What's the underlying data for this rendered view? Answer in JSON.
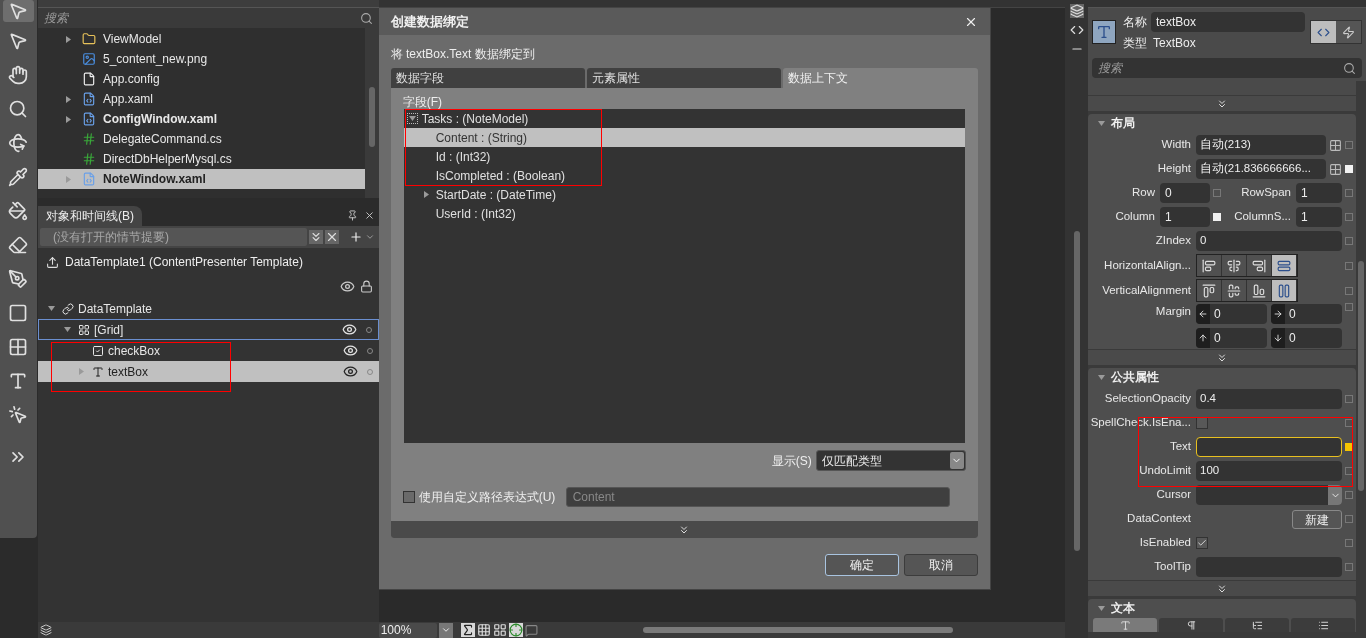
{
  "tools": [
    {
      "kind": "select",
      "selected": true
    },
    {
      "kind": "direct-select",
      "selected": false
    },
    {
      "kind": "pan",
      "selected": false
    },
    {
      "kind": "zoom",
      "selected": false
    },
    {
      "kind": "orbit",
      "selected": false
    },
    {
      "kind": "eyedropper",
      "selected": false
    },
    {
      "kind": "paint-bucket",
      "selected": false
    },
    {
      "kind": "gradient",
      "selected": false
    },
    {
      "kind": "pen",
      "selected": false
    },
    {
      "kind": "rectangle",
      "selected": false
    },
    {
      "kind": "grid",
      "selected": false
    },
    {
      "kind": "textblock",
      "selected": false
    },
    {
      "kind": "button",
      "selected": false
    },
    {
      "kind": "assets",
      "selected": false
    }
  ],
  "project": {
    "search_placeholder": "搜索",
    "items": [
      {
        "label": "ViewModel",
        "kind": "folder",
        "expandable": true,
        "bold": false,
        "selected": false
      },
      {
        "label": "5_content_new.png",
        "kind": "image",
        "expandable": false,
        "bold": false,
        "selected": false
      },
      {
        "label": "App.config",
        "kind": "file",
        "expandable": false,
        "bold": false,
        "selected": false
      },
      {
        "label": "App.xaml",
        "kind": "xaml",
        "expandable": true,
        "bold": false,
        "selected": false
      },
      {
        "label": "ConfigWindow.xaml",
        "kind": "xaml",
        "expandable": true,
        "bold": true,
        "selected": false
      },
      {
        "label": "DelegateCommand.cs",
        "kind": "cs",
        "expandable": false,
        "bold": false,
        "selected": false
      },
      {
        "label": "DirectDbHelperMysql.cs",
        "kind": "cs",
        "expandable": false,
        "bold": false,
        "selected": false
      },
      {
        "label": "NoteWindow.xaml",
        "kind": "xaml",
        "expandable": true,
        "bold": true,
        "selected": true
      }
    ]
  },
  "objects": {
    "title": "对象和时间线(B)",
    "storyboard_placeholder": "(没有打开的情节提要)",
    "scope": "DataTemplate1 (ContentPresenter Template)",
    "tree": [
      {
        "label": "DataTemplate",
        "kind": "template",
        "expanded": true,
        "selected": false,
        "children": [
          {
            "label": "[Grid]",
            "kind": "grid",
            "expanded": true,
            "selected": false,
            "children": [
              {
                "label": "checkBox",
                "kind": "checkbox",
                "selected": false
              },
              {
                "label": "textBox",
                "kind": "textbox",
                "expanded": false,
                "selected": true
              }
            ]
          }
        ]
      }
    ]
  },
  "dialog": {
    "title": "创建数据绑定",
    "subtitle": "将 textBox.Text 数据绑定到",
    "tabs": [
      {
        "label": "数据字段",
        "selected": false
      },
      {
        "label": "元素属性",
        "selected": false
      },
      {
        "label": "数据上下文",
        "selected": true
      }
    ],
    "fields_label": "字段(F)",
    "fields": [
      {
        "label": "Tasks : (NoteModel)",
        "expanded": true,
        "selected": false,
        "children": [
          {
            "label": "Content : (String)",
            "selected": true
          },
          {
            "label": "Id : (Int32)",
            "selected": false
          },
          {
            "label": "IsCompleted : (Boolean)",
            "selected": false
          },
          {
            "label": "StartDate : (DateTime)",
            "selected": false,
            "expanded": false
          },
          {
            "label": "UserId : (Int32)",
            "selected": false
          }
        ]
      }
    ],
    "show_label": "显示(S)",
    "show_value": "仅匹配类型",
    "custom_path": {
      "label": "使用自定义路径表达式(U)",
      "checked": false,
      "placeholder": "Content"
    },
    "buttons": [
      {
        "label": "确定",
        "default": true
      },
      {
        "label": "取消",
        "default": false
      }
    ]
  },
  "status_bar": {
    "zoom": "100%"
  },
  "properties": {
    "name_label": "名称",
    "name": "textBox",
    "type_label": "类型",
    "type": "TextBox",
    "search_placeholder": "搜索",
    "sections": [
      {
        "title": "布局",
        "expanded": true,
        "rows": [
          {
            "kind": "text",
            "label": "Width",
            "value": "自动(213)",
            "auto": true,
            "focused": false,
            "local": false,
            "bound": false
          },
          {
            "kind": "text",
            "label": "Height",
            "value": "自动(21.836666666...",
            "auto": true,
            "focused": false,
            "local": true,
            "bound": false
          },
          {
            "kind": "pair",
            "items": [
              {
                "label": "Row",
                "value": "0",
                "local": false,
                "bound": false
              },
              {
                "label": "RowSpan",
                "value": "1",
                "local": false,
                "bound": false
              }
            ]
          },
          {
            "kind": "pair",
            "items": [
              {
                "label": "Column",
                "value": "1",
                "local": true,
                "bound": false
              },
              {
                "label": "ColumnS...",
                "value": "1",
                "local": false,
                "bound": false
              }
            ]
          },
          {
            "kind": "text",
            "label": "ZIndex",
            "value": "0",
            "auto": false,
            "focused": false,
            "local": false,
            "bound": false
          },
          {
            "kind": "halign",
            "label": "HorizontalAlign...",
            "options": [
              {
                "selected": false
              },
              {
                "selected": false
              },
              {
                "selected": false
              },
              {
                "selected": true
              }
            ],
            "local": false,
            "bound": false
          },
          {
            "kind": "valign",
            "label": "VerticalAlignment",
            "options": [
              {
                "selected": false
              },
              {
                "selected": false
              },
              {
                "selected": false
              },
              {
                "selected": true
              }
            ],
            "local": false,
            "bound": false
          },
          {
            "kind": "margin",
            "label": "Margin",
            "values": [
              "0",
              "0",
              "0",
              "0"
            ],
            "local": false,
            "bound": false
          }
        ]
      },
      {
        "title": "公共属性",
        "expanded": true,
        "rows": [
          {
            "kind": "text",
            "label": "SelectionOpacity",
            "value": "0.4",
            "auto": false,
            "focused": false,
            "local": false,
            "bound": false
          },
          {
            "kind": "checkbox",
            "label": "SpellCheck.IsEna...",
            "checked": false,
            "local": false,
            "bound": false
          },
          {
            "kind": "text",
            "label": "Text",
            "auto": false,
            "focused": true,
            "local": false,
            "bound": true
          },
          {
            "kind": "text",
            "label": "UndoLimit",
            "value": "100",
            "auto": false,
            "focused": false,
            "local": false,
            "bound": false
          },
          {
            "kind": "dropdown",
            "label": "Cursor",
            "local": false,
            "bound": false
          },
          {
            "kind": "button",
            "label": "DataContext",
            "button": "新建",
            "local": false,
            "bound": false
          },
          {
            "kind": "checkbox",
            "label": "IsEnabled",
            "checked": true,
            "local": false,
            "bound": false
          },
          {
            "kind": "text",
            "label": "ToolTip",
            "auto": false,
            "focused": false,
            "local": false,
            "bound": false
          }
        ]
      },
      {
        "title": "文本",
        "expanded": true,
        "rows": [
          {
            "kind": "tabs",
            "options": [
              {
                "kind": "font",
                "selected": true
              },
              {
                "kind": "paragraph",
                "selected": false
              },
              {
                "kind": "indent",
                "selected": false
              },
              {
                "kind": "list",
                "selected": false
              }
            ]
          }
        ]
      }
    ]
  }
}
